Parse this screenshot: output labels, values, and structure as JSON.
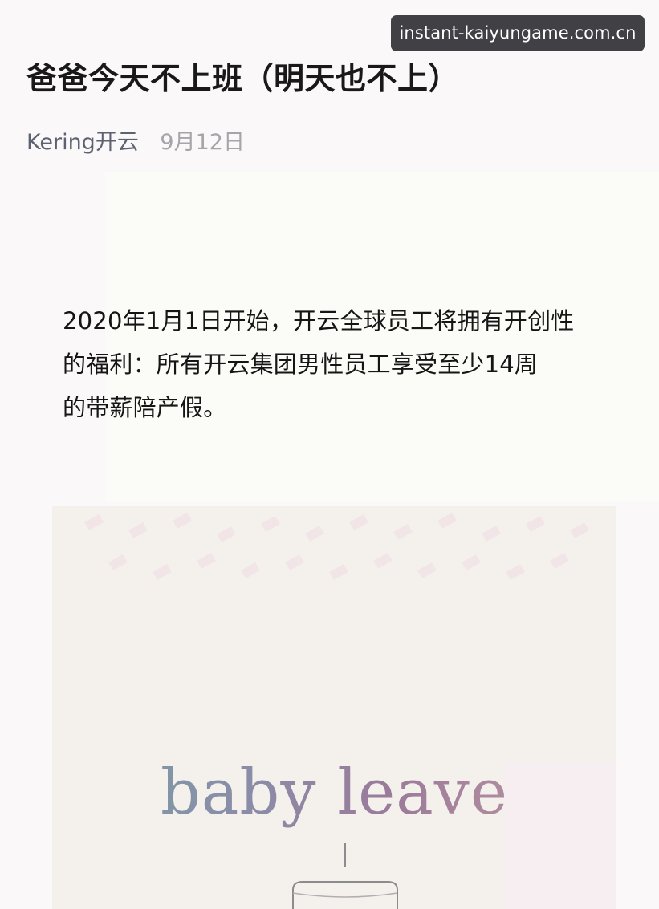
{
  "watermark": {
    "text": "instant-kaiyungame.com.cn"
  },
  "article": {
    "title": "爸爸今天不上班（明天也不上）",
    "account_name": "Kering开云",
    "date": "9月12日",
    "paragraph_lines": [
      "2020年1月1日开始，开云全球员工将拥有开创性",
      "的福利：所有开云集团男性员工享受至少14周",
      "的带薪陪产假。"
    ]
  },
  "poster": {
    "headline": "baby leave",
    "icon": "cake-outline-icon",
    "colors": {
      "gradient": [
        "#7aa0a6",
        "#8b8ca8",
        "#9a7b9a",
        "#c49aa2"
      ],
      "background": "#f4f1ed"
    }
  }
}
